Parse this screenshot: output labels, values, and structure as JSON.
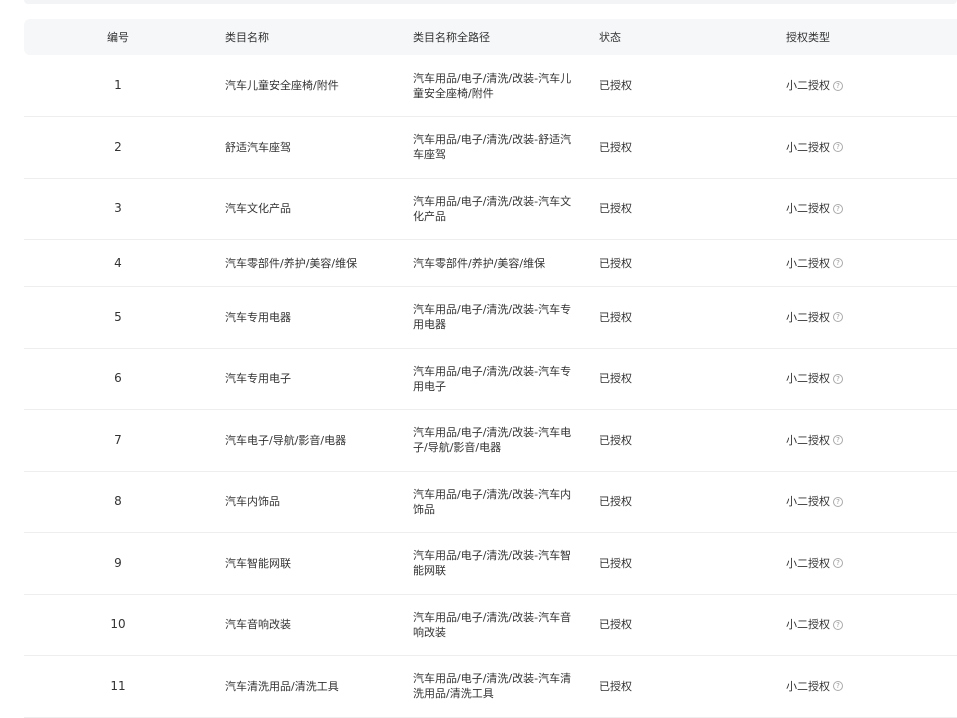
{
  "table": {
    "headers": {
      "id": "编号",
      "name": "类目名称",
      "path": "类目名称全路径",
      "status": "状态",
      "auth_type": "授权类型"
    },
    "rows": [
      {
        "id": "1",
        "name": "汽车儿童安全座椅/附件",
        "path": "汽车用品/电子/清洗/改装-汽车儿童安全座椅/附件",
        "status": "已授权",
        "auth_type": "小二授权"
      },
      {
        "id": "2",
        "name": "舒适汽车座驾",
        "path": "汽车用品/电子/清洗/改装-舒适汽车座驾",
        "status": "已授权",
        "auth_type": "小二授权"
      },
      {
        "id": "3",
        "name": "汽车文化产品",
        "path": "汽车用品/电子/清洗/改装-汽车文化产品",
        "status": "已授权",
        "auth_type": "小二授权"
      },
      {
        "id": "4",
        "name": "汽车零部件/养护/美容/维保",
        "path": "汽车零部件/养护/美容/维保",
        "status": "已授权",
        "auth_type": "小二授权"
      },
      {
        "id": "5",
        "name": "汽车专用电器",
        "path": "汽车用品/电子/清洗/改装-汽车专用电器",
        "status": "已授权",
        "auth_type": "小二授权"
      },
      {
        "id": "6",
        "name": "汽车专用电子",
        "path": "汽车用品/电子/清洗/改装-汽车专用电子",
        "status": "已授权",
        "auth_type": "小二授权"
      },
      {
        "id": "7",
        "name": "汽车电子/导航/影音/电器",
        "path": "汽车用品/电子/清洗/改装-汽车电子/导航/影音/电器",
        "status": "已授权",
        "auth_type": "小二授权"
      },
      {
        "id": "8",
        "name": "汽车内饰品",
        "path": "汽车用品/电子/清洗/改装-汽车内饰品",
        "status": "已授权",
        "auth_type": "小二授权"
      },
      {
        "id": "9",
        "name": "汽车智能网联",
        "path": "汽车用品/电子/清洗/改装-汽车智能网联",
        "status": "已授权",
        "auth_type": "小二授权"
      },
      {
        "id": "10",
        "name": "汽车音响改装",
        "path": "汽车用品/电子/清洗/改装-汽车音响改装",
        "status": "已授权",
        "auth_type": "小二授权"
      },
      {
        "id": "11",
        "name": "汽车清洗用品/清洗工具",
        "path": "汽车用品/电子/清洗/改装-汽车清洗用品/清洗工具",
        "status": "已授权",
        "auth_type": "小二授权"
      }
    ],
    "help_icon": "question-circle-icon"
  }
}
